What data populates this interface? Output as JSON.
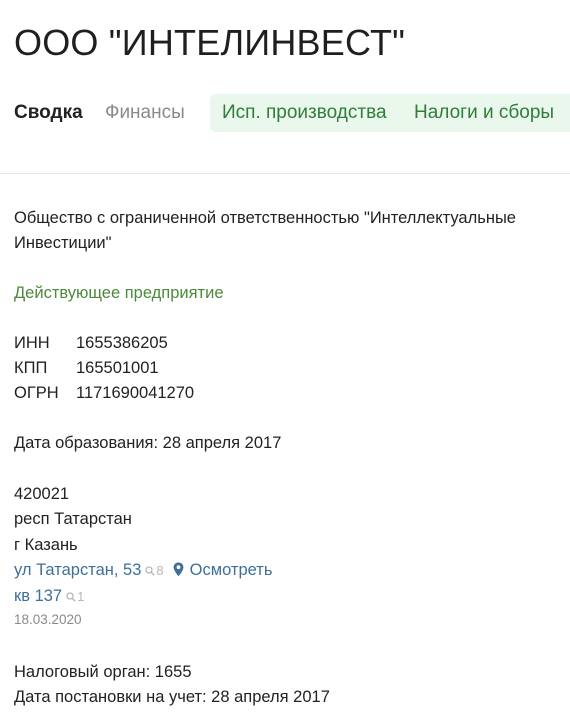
{
  "company": {
    "title": "ООО \"ИНТЕЛИНВЕСТ\"",
    "full_name": "Общество с ограниченной ответственностью \"Интеллектуальные Инвестиции\"",
    "status": "Действующее предприятие"
  },
  "tabs": [
    {
      "label": "Сводка"
    },
    {
      "label": "Финансы"
    },
    {
      "label": "Исп. производства"
    },
    {
      "label": "Налоги и сборы"
    }
  ],
  "identifiers": [
    {
      "label": "ИНН",
      "value": "1655386205"
    },
    {
      "label": "КПП",
      "value": "165501001"
    },
    {
      "label": "ОГРН",
      "value": "1171690041270"
    }
  ],
  "registration_date": "Дата образования: 28 апреля 2017",
  "address": {
    "postal_code": "420021",
    "region": "респ Татарстан",
    "city": "г Казань",
    "street": "ул Татарстан, 53",
    "street_count": "8",
    "view_label": "Осмотреть",
    "apartment": "кв 137",
    "apartment_count": "1",
    "updated": "18.03.2020"
  },
  "tax": {
    "office": "Налоговый орган: 1655",
    "registered": "Дата постановки на учет: 28 апреля 2017"
  },
  "colors": {
    "green_status": "#4a8a3a",
    "green_tab_bg": "#e9f7ec",
    "link_blue": "#3d6f9a"
  },
  "icons": {
    "search": "magnifier-icon",
    "location": "map-pin-icon"
  }
}
